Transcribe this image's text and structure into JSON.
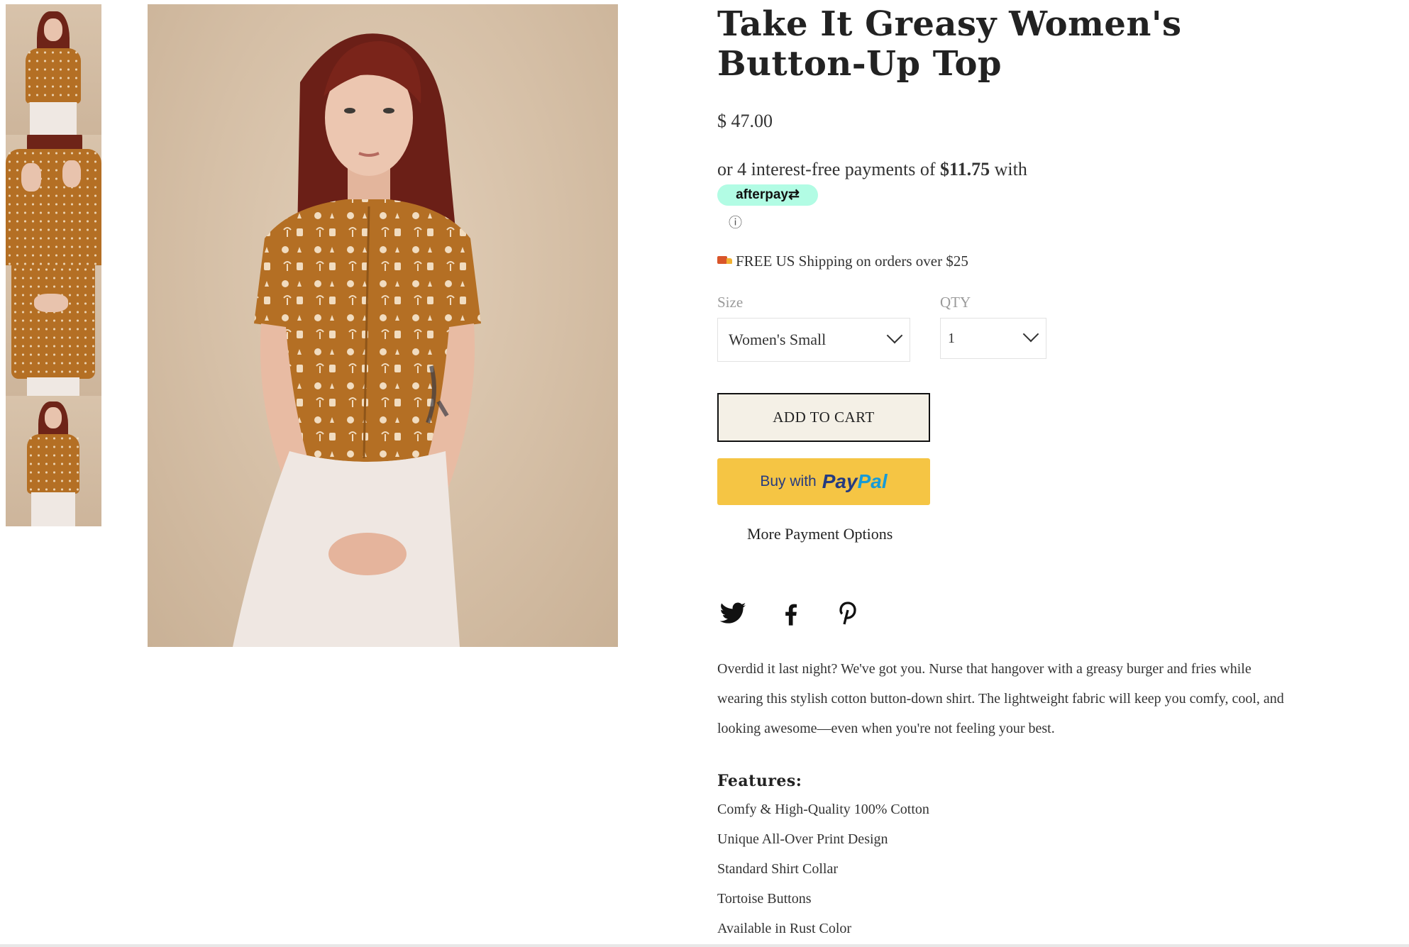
{
  "product": {
    "title": "Take It Greasy Women's Button-Up Top",
    "price": "$ 47.00",
    "afterpay": {
      "prefix": "or 4 interest-free payments of",
      "amount": "$11.75",
      "suffix": "with",
      "badge": "afterpay⇄",
      "info": "ⓘ"
    },
    "shipping": "FREE US Shipping on orders over $25"
  },
  "options": {
    "size_label": "Size",
    "size_value": "Women's Small",
    "qty_label": "QTY",
    "qty_value": "1"
  },
  "buttons": {
    "add_to_cart": "ADD TO CART",
    "paypal_prefix": "Buy with",
    "paypal_brand_1": "Pay",
    "paypal_brand_2": "Pal",
    "more_payment": "More Payment Options"
  },
  "social": [
    "twitter-icon",
    "facebook-icon",
    "pinterest-icon"
  ],
  "description": "Overdid it last night? We've got you. Nurse that hangover with a greasy burger and fries while wearing this stylish cotton button-down shirt. The lightweight fabric will keep you comfy, cool, and looking awesome—even when you're not feeling your best.",
  "features": {
    "heading": "Features:",
    "items": [
      "Comfy & High-Quality 100% Cotton",
      "Unique All-Over Print Design",
      "Standard Shirt Collar",
      "Tortoise Buttons",
      "Available in Rust Color"
    ]
  },
  "colors": {
    "afterpay_mint": "#b2fce4",
    "paypal_yellow": "#f5c544",
    "cart_bg": "#f4f0e6",
    "shirt_rust": "#b46f24"
  }
}
